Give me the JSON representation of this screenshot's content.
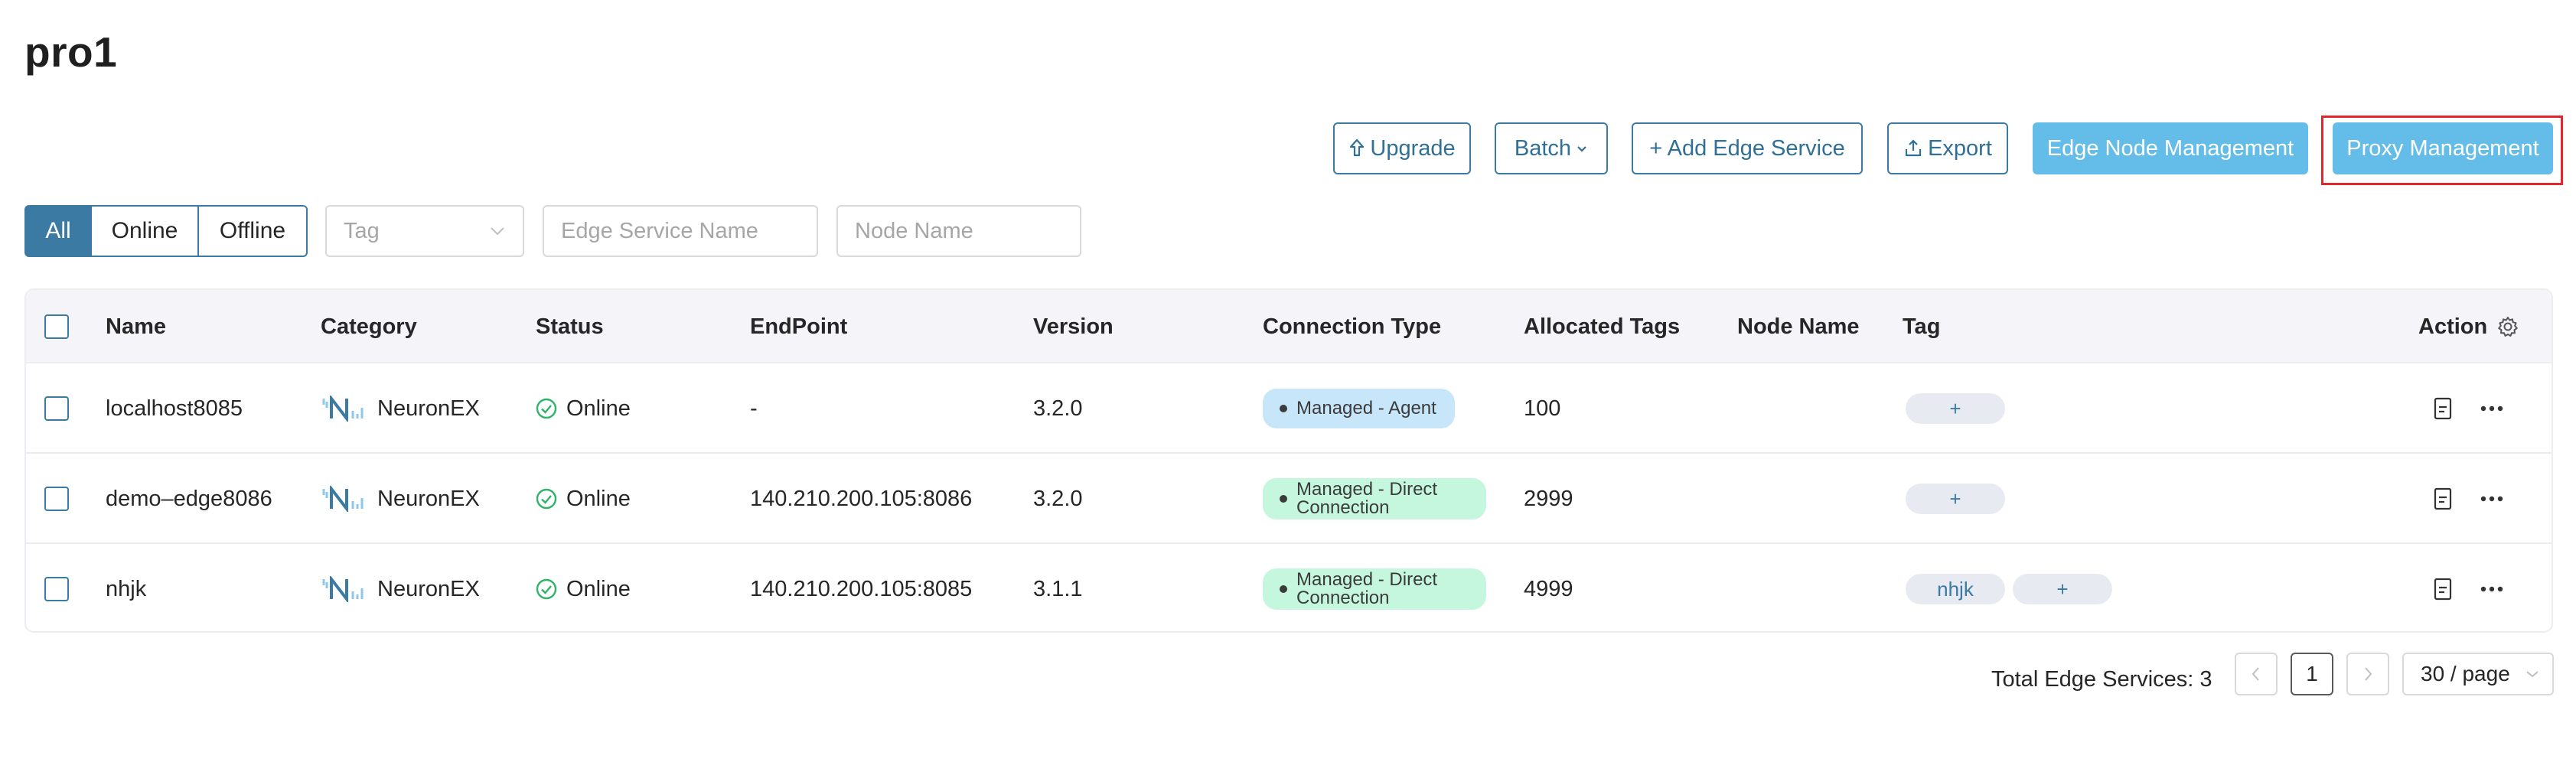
{
  "page": {
    "title": "pro1"
  },
  "toolbar": {
    "upgrade_label": "Upgrade",
    "batch_label": "Batch",
    "add_label": "+ Add Edge Service",
    "export_label": "Export",
    "edge_node_label": "Edge Node Management",
    "proxy_label": "Proxy Management"
  },
  "filters": {
    "status_tabs": [
      "All",
      "Online",
      "Offline"
    ],
    "active_tab": "All",
    "tag_placeholder": "Tag",
    "service_name_placeholder": "Edge Service Name",
    "node_name_placeholder": "Node Name"
  },
  "table": {
    "columns": {
      "name": "Name",
      "category": "Category",
      "status": "Status",
      "endpoint": "EndPoint",
      "version": "Version",
      "connection_type": "Connection Type",
      "allocated_tags": "Allocated Tags",
      "node_name": "Node Name",
      "tag": "Tag",
      "action": "Action"
    },
    "rows": [
      {
        "name": "localhost8085",
        "category": "NeuronEX",
        "status": "Online",
        "endpoint": "-",
        "version": "3.2.0",
        "connection_type": "Managed - Agent",
        "allocated_tags": "100",
        "node_name": "",
        "tags": [],
        "add_tag": "+"
      },
      {
        "name": "demo–edge8086",
        "category": "NeuronEX",
        "status": "Online",
        "endpoint": "140.210.200.105:8086",
        "version": "3.2.0",
        "connection_type_line1": "Managed - Direct",
        "connection_type_line2": "Connection",
        "allocated_tags": "2999",
        "node_name": "",
        "tags": [],
        "add_tag": "+"
      },
      {
        "name": "nhjk",
        "category": "NeuronEX",
        "status": "Online",
        "endpoint": "140.210.200.105:8085",
        "version": "3.1.1",
        "connection_type_line1": "Managed - Direct",
        "connection_type_line2": "Connection",
        "allocated_tags": "4999",
        "node_name": "",
        "tags": [
          "nhjk"
        ],
        "add_tag": "+"
      }
    ]
  },
  "pagination": {
    "total_label": "Total Edge Services: 3",
    "current_page": "1",
    "page_size": "30 / page"
  },
  "colors": {
    "primary": "#3a7aa3",
    "primary_light": "#64bde9",
    "online_green": "#2fb36b",
    "highlight_red": "#e2262d"
  },
  "icons": {
    "upgrade": "upload-arrow-icon",
    "export": "export-icon",
    "settings": "gear-icon",
    "detail": "document-icon",
    "more": "ellipsis-icon"
  }
}
